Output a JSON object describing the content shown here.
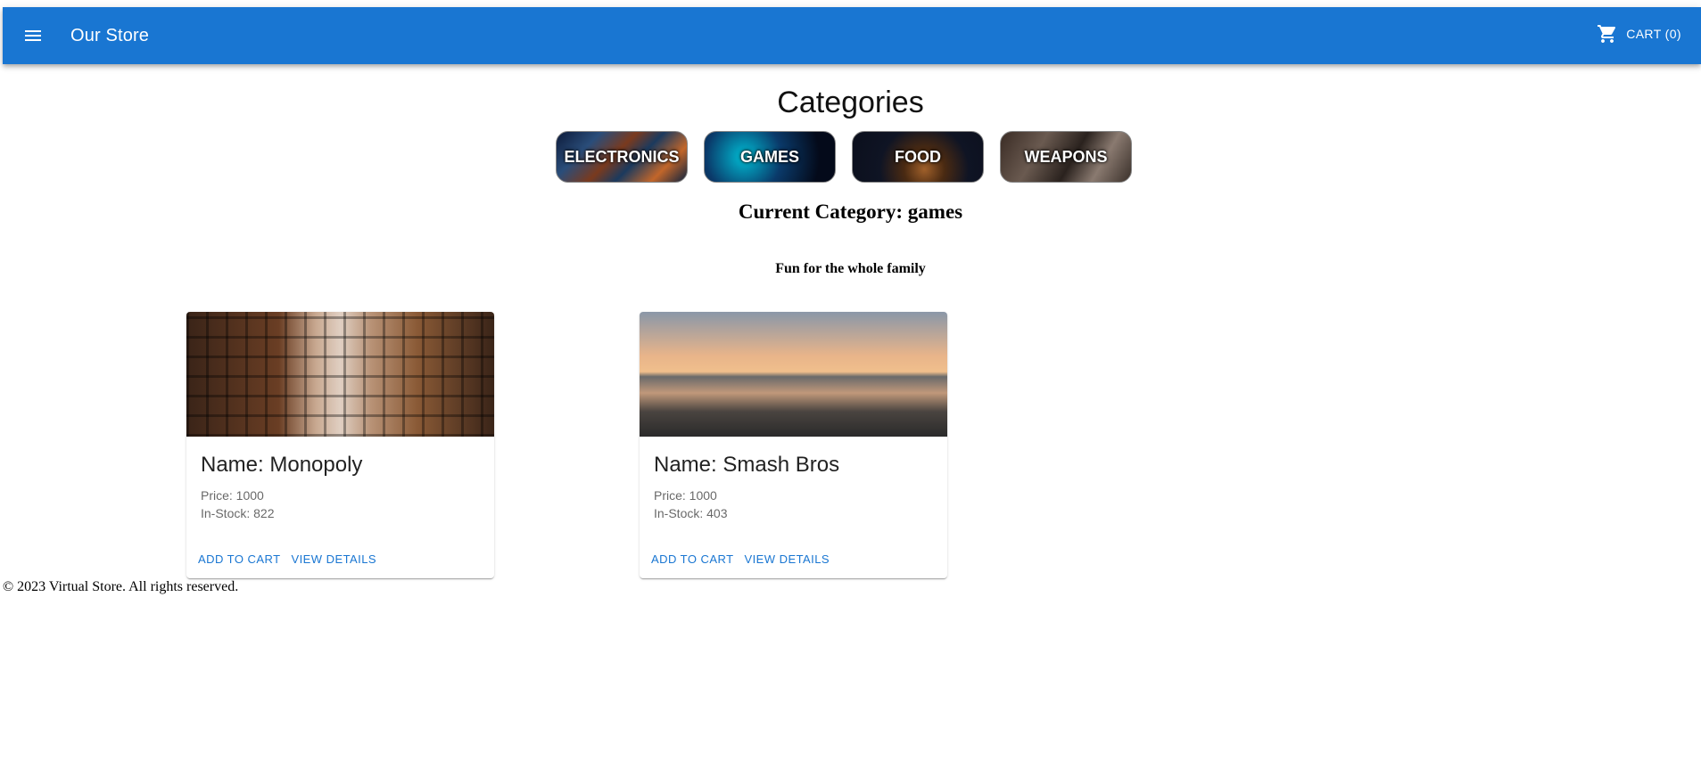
{
  "appbar": {
    "title": "Our Store",
    "menu_icon": "menu-icon",
    "cart_icon": "shopping-cart-icon",
    "cart_label": "CART (0)",
    "color": "#1976d2"
  },
  "heading": "Categories",
  "categories": [
    {
      "label": "ELECTRONICS"
    },
    {
      "label": "GAMES"
    },
    {
      "label": "FOOD"
    },
    {
      "label": "WEAPONS"
    }
  ],
  "current_category": "Current Category: games",
  "category_description": "Fun for the whole family",
  "products": [
    {
      "name": "Name: Monopoly",
      "price": "Price: 1000",
      "stock": "In-Stock: 822",
      "add_label": "ADD TO CART",
      "details_label": "VIEW DETAILS"
    },
    {
      "name": "Name: Smash Bros",
      "price": "Price: 1000",
      "stock": "In-Stock: 403",
      "add_label": "ADD TO CART",
      "details_label": "VIEW DETAILS"
    }
  ],
  "footer": "© 2023 Virtual Store. All rights reserved."
}
